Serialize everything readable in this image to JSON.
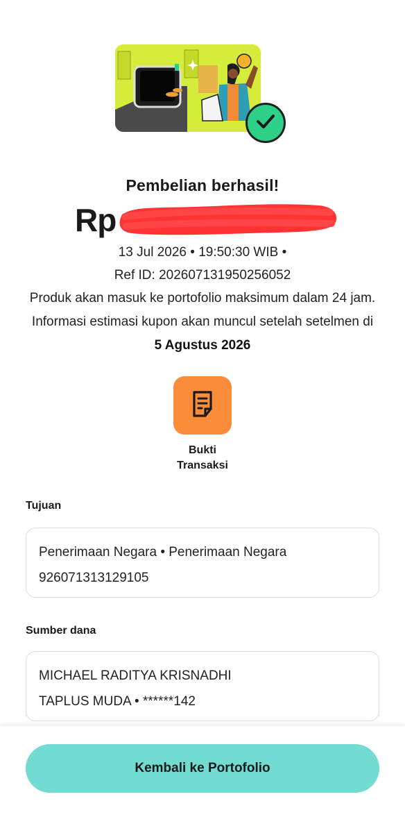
{
  "illustration": {
    "name": "purchase-success-illustration",
    "background_color": "#d6ec3a",
    "badge_color": "#2ecf86",
    "badge_icon": "check-icon"
  },
  "status": {
    "title": "Pembelian berhasil!"
  },
  "amount": {
    "currency": "Rp",
    "value_redacted": true,
    "redact_color": "#ff3333"
  },
  "transaction": {
    "datetime": "13 Jul 2026 • 19:50:30 WIB •",
    "ref_id": "Ref ID: 20260713195025605​2",
    "info_text": "Produk akan masuk ke portofolio maksimum dalam 24 jam. Informasi estimasi kupon akan muncul setelah setelmen di ",
    "settlement_date": "5 Agustus 2026"
  },
  "receipt": {
    "icon": "document-icon",
    "label_line1": "Bukti",
    "label_line2": "Transaksi",
    "color": "#fb8c3a"
  },
  "destination": {
    "label": "Tujuan",
    "line1": "Penerimaan Negara • Penerimaan Negara",
    "line2": "926071313129105"
  },
  "source": {
    "label": "Sumber dana",
    "line1": "MICHAEL RADITYA KRISNADHI",
    "line2": "TAPLUS MUDA • ******142"
  },
  "footer": {
    "button_label": "Kembali ke Portofolio",
    "button_color": "#72dbd2"
  }
}
